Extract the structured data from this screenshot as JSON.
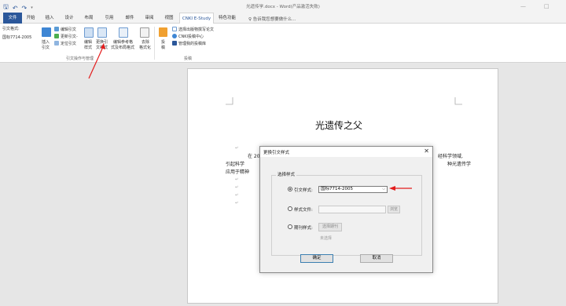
{
  "window": {
    "title": "光遗传学.docx - Word(产品激活失败)",
    "min_label": "—",
    "restore_label": "□"
  },
  "qat": {
    "save_icon": "🖫",
    "undo_icon": "↶",
    "redo_icon": "↷",
    "more_icon": "▾"
  },
  "tabs": [
    {
      "label": "文件"
    },
    {
      "label": "开始"
    },
    {
      "label": "插入"
    },
    {
      "label": "设计"
    },
    {
      "label": "布局"
    },
    {
      "label": "引用"
    },
    {
      "label": "邮件"
    },
    {
      "label": "审阅"
    },
    {
      "label": "视图"
    },
    {
      "label": "CNKI E-Study"
    },
    {
      "label": "特色功能"
    }
  ],
  "tellme": "♀ 告诉我您想要做什么...",
  "ribbon": {
    "style_label": "引文格式:",
    "style_value": "国标7714-2005",
    "insert_cite": "插入",
    "insert_cite2": "引文",
    "edit_cite": "编辑引文",
    "update_cite": "更新引文-",
    "locate_cite": "定位引文",
    "edit_style": "编辑",
    "edit_style2": "样式",
    "change_style": "更换引",
    "change_style2": "文样式",
    "edit_ref": "编辑参考格",
    "edit_ref2": "式及布局格式",
    "remove_format": "去除",
    "remove_format2": "格式化",
    "submit": "投",
    "submit2": "稿",
    "choose_journal": "选择出版物撰写论文",
    "cnki_center": "CNKI投稿中心",
    "manage_submit": "管理我的投稿库",
    "group_cite": "引文操作与管理",
    "group_submit": "投稿"
  },
  "document": {
    "title": "光遗传之父",
    "line1_pre": "在 20",
    "line1_post": "经科学领域,",
    "line2_pre": "引起科学",
    "line2_post": "种光遗传学",
    "line3_pre": "应用于精神",
    "para_mark": "↵"
  },
  "dialog": {
    "title": "更换引文样式",
    "close": "✕",
    "group_title": "选择样式",
    "opt_cite_label": "引文样式:",
    "opt_cite_value": "国标7714-2005",
    "opt_file_label": "样式文件:",
    "browse_label": "浏览",
    "opt_journal_label": "期刊样式:",
    "choose_journal_label": "选择期刊",
    "unselected_label": "未选择",
    "ok_label": "确定",
    "cancel_label": "取消"
  },
  "colors": {
    "accent": "#2b579a",
    "arrow": "#e31c1c"
  }
}
